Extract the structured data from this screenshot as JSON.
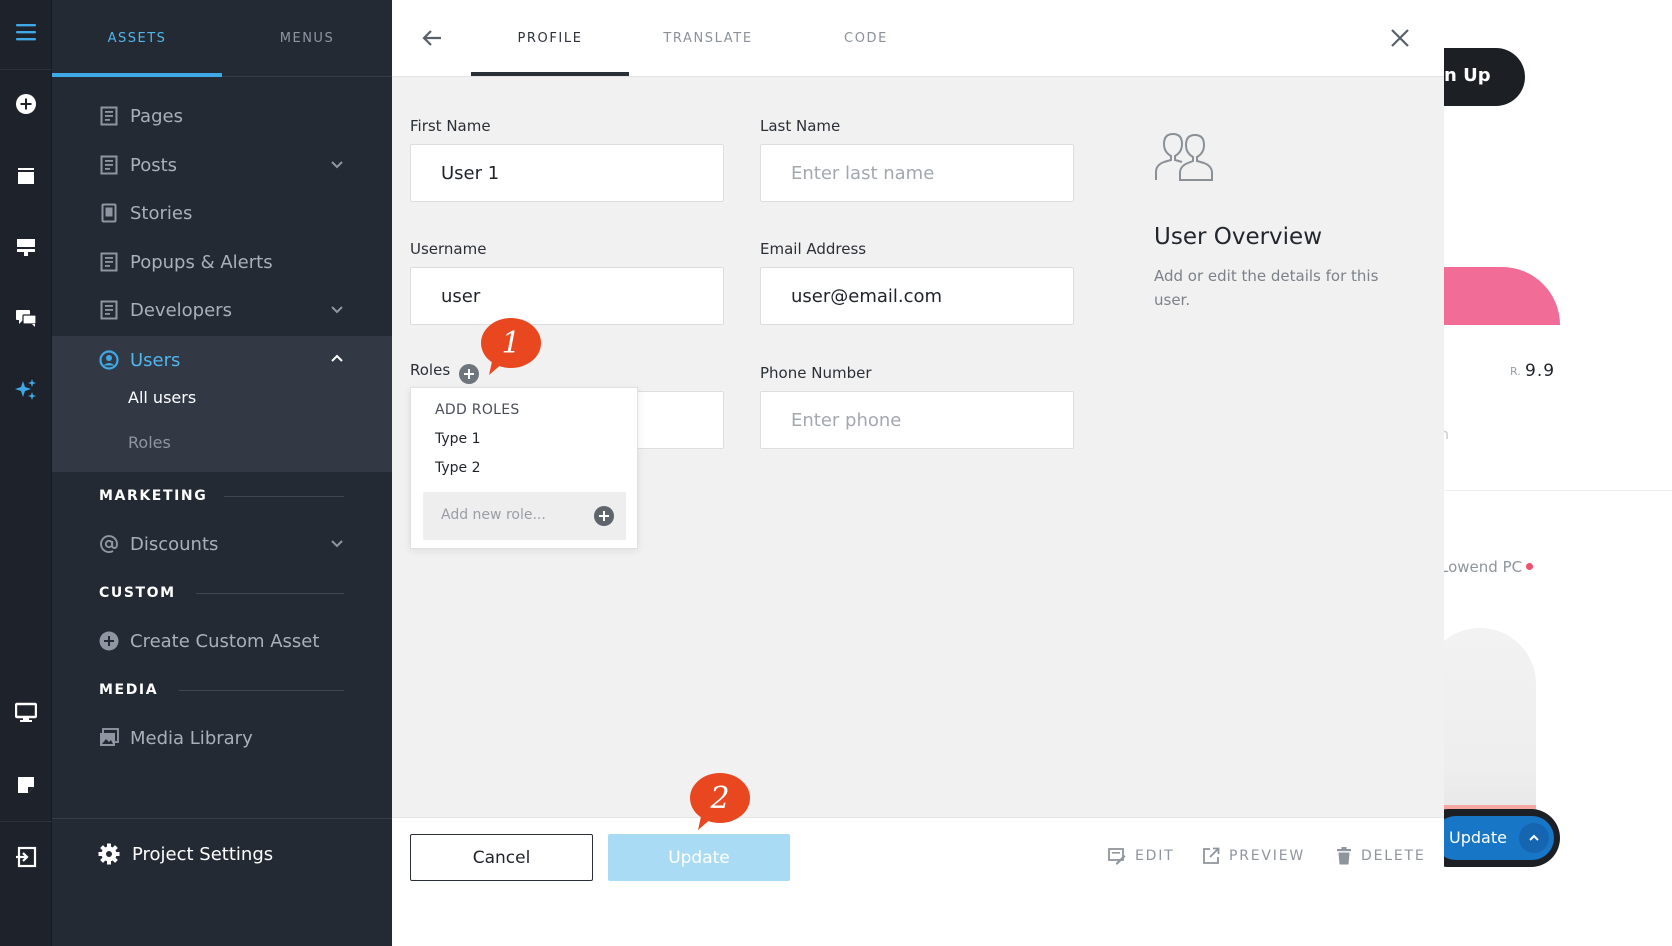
{
  "sidebar": {
    "tabs": [
      {
        "label": "ASSETS",
        "active": true
      },
      {
        "label": "MENUS",
        "active": false
      }
    ],
    "items": [
      {
        "label": "Pages",
        "icon": "page-icon"
      },
      {
        "label": "Posts",
        "icon": "page-icon",
        "expandable": true
      },
      {
        "label": "Stories",
        "icon": "tablet-icon"
      },
      {
        "label": "Popups & Alerts",
        "icon": "page-icon"
      },
      {
        "label": "Developers",
        "icon": "page-icon",
        "expandable": true
      },
      {
        "label": "Users",
        "icon": "user-circle-icon",
        "expanded": true
      }
    ],
    "users_sub": [
      "All users",
      "Roles"
    ],
    "sections": {
      "marketing": "MARKETING",
      "discounts": "Discounts",
      "custom": "CUSTOM",
      "create_custom_asset": "Create Custom Asset",
      "media": "MEDIA",
      "media_library": "Media Library"
    },
    "project_settings": "Project Settings"
  },
  "modal": {
    "tabs": [
      {
        "label": "PROFILE",
        "active": true
      },
      {
        "label": "TRANSLATE",
        "active": false
      },
      {
        "label": "CODE",
        "active": false
      }
    ],
    "form": {
      "first_name": {
        "label": "First Name",
        "value": "User 1",
        "placeholder": ""
      },
      "last_name": {
        "label": "Last Name",
        "value": "",
        "placeholder": "Enter last name"
      },
      "username": {
        "label": "Username",
        "value": "user"
      },
      "email": {
        "label": "Email Address",
        "value": "user@email.com"
      },
      "roles": {
        "label": "Roles"
      },
      "phone": {
        "label": "Phone Number",
        "value": "",
        "placeholder": "Enter phone"
      }
    },
    "roles_dropdown": {
      "header": "ADD ROLES",
      "options": [
        "Type 1",
        "Type 2"
      ],
      "new_role_placeholder": "Add new role..."
    },
    "overview": {
      "title": "User Overview",
      "description": "Add or edit the details for this user."
    },
    "callouts": [
      "1",
      "2"
    ],
    "footer": {
      "cancel": "Cancel",
      "update": "Update",
      "edit": "EDIT",
      "preview": "PREVIEW",
      "delete": "DELETE"
    }
  },
  "background_page": {
    "signup_fragment": "n Up",
    "rating_prefix": "R.",
    "rating_value": "9.9",
    "fragment_n": "n",
    "store_fragment": "Lowend PC",
    "update_button": "Update"
  },
  "colors": {
    "accent": "#3fa8e6",
    "sidebar_bg": "#242a33",
    "rail_bg": "#1e232b",
    "callout": "#e8471f",
    "update_disabled": "#a9dcf4",
    "pink": "#f06292"
  }
}
